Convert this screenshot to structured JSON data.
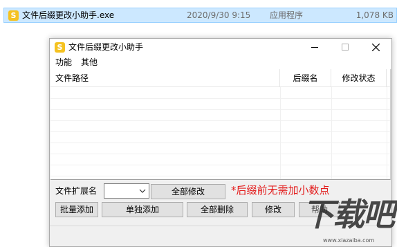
{
  "file_row": {
    "icon_letter": "S",
    "name": "文件后缀更改小助手.exe",
    "date": "2020/9/30 9:15",
    "type": "应用程序",
    "size": "1,078 KB"
  },
  "window": {
    "icon_letter": "S",
    "title": "文件后缀更改小助手",
    "menu": [
      "功能",
      "其他"
    ],
    "columns": [
      "文件路径",
      "后缀名",
      "修改状态"
    ],
    "ext_label": "文件扩展名",
    "ext_value": "",
    "modify_all_label": "全部修改",
    "hint": "*后缀前无需加小数点",
    "buttons": {
      "batch_add": "批量添加",
      "single_add": "单独添加",
      "delete_all": "全部删除",
      "modify": "修改",
      "extra": "帮助"
    }
  },
  "watermark": {
    "logo": "下载吧",
    "url": "www.xiazaiba.com"
  },
  "colors": {
    "selection_bg": "#cce8ff",
    "icon_yellow": "#f5c220",
    "hint_red": "#e31b1b"
  }
}
